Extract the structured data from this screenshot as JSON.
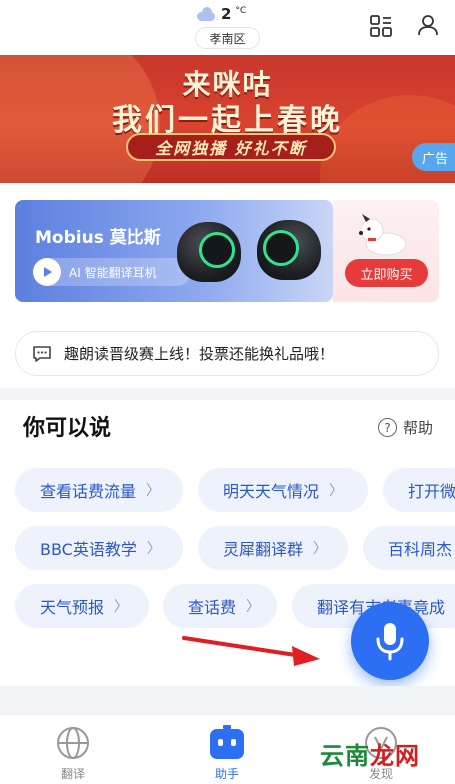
{
  "header": {
    "temperature": "2",
    "temperature_unit": "°C",
    "district": "孝南区"
  },
  "banner": {
    "line1": "来咪咕",
    "line2": "我们一起上春晚",
    "ribbon": "全网独播 好礼不断",
    "ad_tag": "广告"
  },
  "promo": {
    "product_title": "Mobius 莫比斯",
    "product_subtitle": "AI 智能翻译耳机",
    "buy_label": "立即购买"
  },
  "notice": {
    "text": "趣朗读晋级赛上线！投票还能换礼品哦！"
  },
  "say_section": {
    "title": "你可以说",
    "help_label": "帮助",
    "chips": [
      [
        "查看话费流量",
        "明天天气情况",
        "打开微"
      ],
      [
        "BBC英语教学",
        "灵犀翻译群",
        "百科周杰"
      ],
      [
        "天气预报",
        "查话费",
        "翻译有志者事竟成"
      ]
    ]
  },
  "tabbar": {
    "items": [
      {
        "label": "翻译",
        "icon": "globe-icon"
      },
      {
        "label": "助手",
        "icon": "robot-icon"
      },
      {
        "label": "发现",
        "icon": "compass-icon"
      }
    ]
  },
  "watermark": {
    "part1": "云南",
    "part2": "龙网"
  },
  "colors": {
    "accent": "#2d6ff3",
    "chip_bg": "#edf2fc",
    "chip_text": "#2c59c6",
    "banner_red": "#d9432f"
  }
}
